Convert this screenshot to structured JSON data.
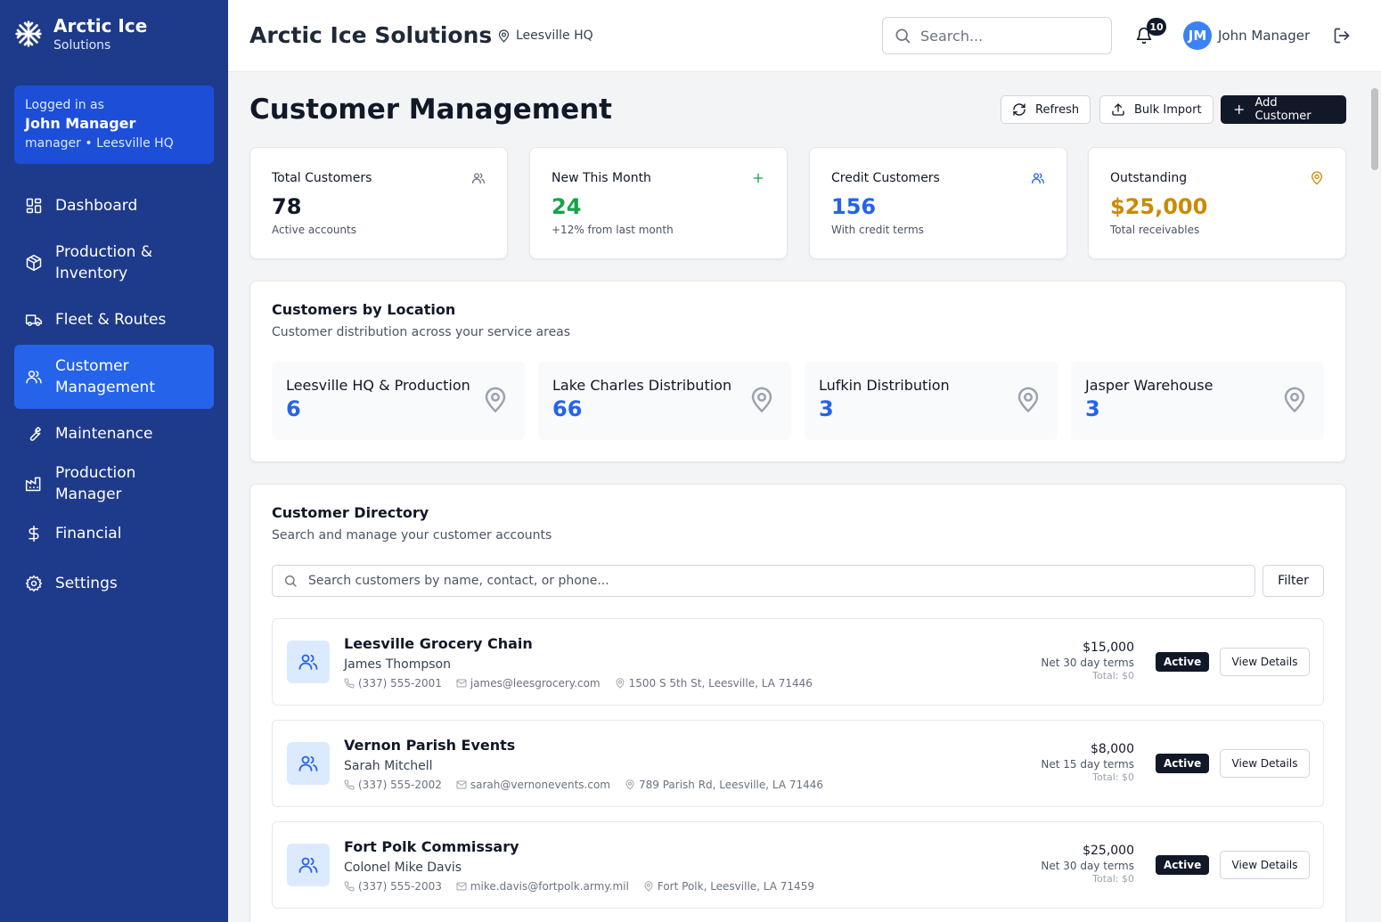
{
  "brand": {
    "title": "Arctic Ice",
    "subtitle": "Solutions",
    "icon": "snowflake-icon"
  },
  "login": {
    "label": "Logged in as",
    "name": "John Manager",
    "role": "manager • Leesville HQ"
  },
  "nav": [
    {
      "label": "Dashboard",
      "icon": "dashboard-icon"
    },
    {
      "label": "Production & Inventory",
      "icon": "package-icon"
    },
    {
      "label": "Fleet & Routes",
      "icon": "truck-icon"
    },
    {
      "label": "Customer Management",
      "icon": "users-icon",
      "active": true
    },
    {
      "label": "Maintenance",
      "icon": "wrench-icon"
    },
    {
      "label": "Production Manager",
      "icon": "factory-icon"
    },
    {
      "label": "Financial",
      "icon": "dollar-icon"
    },
    {
      "label": "Settings",
      "icon": "gear-icon"
    }
  ],
  "header": {
    "title": "Arctic Ice Solutions",
    "location": "Leesville HQ",
    "search_placeholder": "Search...",
    "notifications": "10",
    "avatar_initials": "JM",
    "user_name": "John Manager"
  },
  "page": {
    "title": "Customer Management",
    "refresh_label": "Refresh",
    "bulk_import_label": "Bulk Import",
    "add_customer_label": "Add Customer"
  },
  "stats": [
    {
      "label": "Total Customers",
      "value": "78",
      "sub": "Active accounts",
      "color": "#111827",
      "icon": "users-icon"
    },
    {
      "label": "New This Month",
      "value": "24",
      "sub": "+12% from last month",
      "color": "#16a34a",
      "icon": "plus-icon"
    },
    {
      "label": "Credit Customers",
      "value": "156",
      "sub": "With credit terms",
      "color": "#2563eb",
      "icon": "users-icon"
    },
    {
      "label": "Outstanding",
      "value": "$25,000",
      "sub": "Total receivables",
      "color": "#ca8a04",
      "icon": "map-pin-icon"
    }
  ],
  "locations": {
    "title": "Customers by Location",
    "description": "Customer distribution across your service areas",
    "items": [
      {
        "name": "Leesville HQ & Production",
        "count": "6"
      },
      {
        "name": "Lake Charles Distribution",
        "count": "66"
      },
      {
        "name": "Lufkin Distribution",
        "count": "3"
      },
      {
        "name": "Jasper Warehouse",
        "count": "3"
      }
    ]
  },
  "directory": {
    "title": "Customer Directory",
    "description": "Search and manage your customer accounts",
    "search_placeholder": "Search customers by name, contact, or phone...",
    "filter_label": "Filter",
    "customers": [
      {
        "name": "Leesville Grocery Chain",
        "contact": "James Thompson",
        "phone": "(337) 555-2001",
        "email": "james@leesgrocery.com",
        "address": "1500 S 5th St, Leesville, LA 71446",
        "amount": "$15,000",
        "terms": "Net 30 day terms",
        "total": "Total: $0",
        "status": "Active",
        "action": "View Details"
      },
      {
        "name": "Vernon Parish Events",
        "contact": "Sarah Mitchell",
        "phone": "(337) 555-2002",
        "email": "sarah@vernonevents.com",
        "address": "789 Parish Rd, Leesville, LA 71446",
        "amount": "$8,000",
        "terms": "Net 15 day terms",
        "total": "Total: $0",
        "status": "Active",
        "action": "View Details"
      },
      {
        "name": "Fort Polk Commissary",
        "contact": "Colonel Mike Davis",
        "phone": "(337) 555-2003",
        "email": "mike.davis@fortpolk.army.mil",
        "address": "Fort Polk, Leesville, LA 71459",
        "amount": "$25,000",
        "terms": "Net 30 day terms",
        "total": "Total: $0",
        "status": "Active",
        "action": "View Details"
      }
    ]
  }
}
